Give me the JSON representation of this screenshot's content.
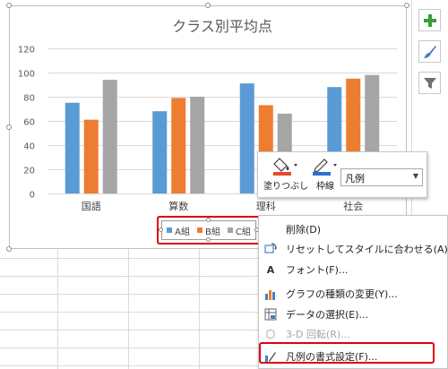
{
  "chart_data": {
    "type": "bar",
    "title": "クラス別平均点",
    "categories": [
      "国語",
      "算数",
      "理科",
      "社会"
    ],
    "series": [
      {
        "name": "A組",
        "values": [
          75,
          68,
          91,
          88
        ],
        "color": "#5b9bd5"
      },
      {
        "name": "B組",
        "values": [
          61,
          79,
          73,
          95
        ],
        "color": "#ed7d31"
      },
      {
        "name": "C組",
        "values": [
          94,
          80,
          66,
          98
        ],
        "color": "#a5a5a5"
      }
    ],
    "ylim": [
      0,
      120
    ],
    "yticks": [
      0,
      20,
      40,
      60,
      80,
      100,
      120
    ],
    "grid": true,
    "legend": "bottom"
  },
  "side_buttons": [
    {
      "icon": "plus-icon",
      "color": "#3a9c3a"
    },
    {
      "icon": "brush-icon",
      "color": "#4a7ec0"
    },
    {
      "icon": "filter-icon",
      "color": "#707070"
    }
  ],
  "mini_toolbar": {
    "fill_label": "塗りつぶし",
    "outline_label": "枠線",
    "selector_value": "凡例",
    "fill_color": "#e8492b",
    "outline_color": "#2e6fd0"
  },
  "context_menu": {
    "items": [
      {
        "label": "削除(D)",
        "icon": "",
        "disabled": false
      },
      {
        "label": "リセットしてスタイルに合わせる(A)",
        "icon": "reset-style-icon",
        "disabled": false
      },
      {
        "label": "フォント(F)...",
        "icon": "font-icon",
        "disabled": false
      },
      {
        "label": "グラフの種類の変更(Y)...",
        "icon": "chart-type-icon",
        "disabled": false
      },
      {
        "label": "データの選択(E)...",
        "icon": "select-data-icon",
        "disabled": false
      },
      {
        "label": "3-D 回転(R)...",
        "icon": "rotate-3d-icon",
        "disabled": true
      },
      {
        "label": "凡例の書式設定(F)...",
        "icon": "format-legend-icon",
        "disabled": false
      }
    ]
  },
  "highlight_color": "#e00010"
}
